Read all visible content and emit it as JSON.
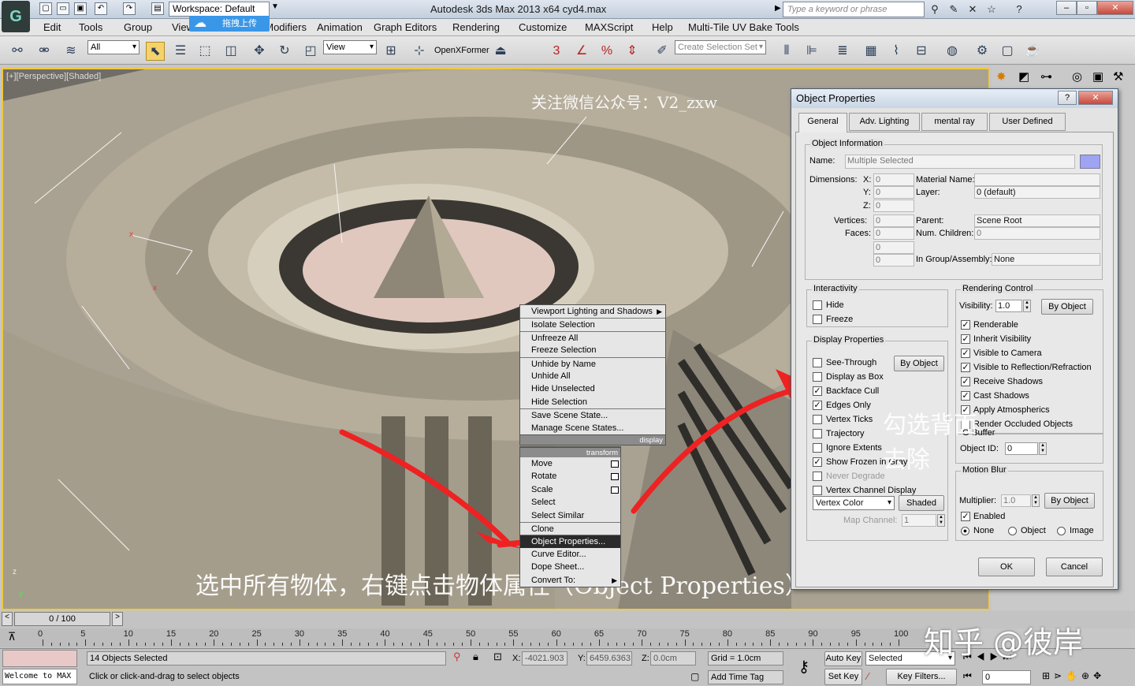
{
  "titlebar": {
    "workspace": "Workspace: Default",
    "upload": "拖拽上传",
    "app_title": "Autodesk 3ds Max  2013 x64      cyd4.max",
    "search_placeholder": "Type a keyword or phrase"
  },
  "menu": [
    "Edit",
    "Tools",
    "Group",
    "Views",
    "Create",
    "Modifiers",
    "Animation",
    "Graph Editors",
    "Rendering",
    "Customize",
    "MAXScript",
    "Help",
    "Multi-Tile UV Bake Tools"
  ],
  "toolbar": {
    "filter": "All",
    "refcoord": "View",
    "openxformer": "OpenXFormer",
    "selset_placeholder": "Create Selection Set"
  },
  "viewport": {
    "label": "[+][Perspective][Shaded]",
    "watermark_top": "关注微信公众号：V2_zxw",
    "watermark_bottom": "选中所有物体，右键点击物体属性（Object  Properties）",
    "annotation": "勾选背面去除",
    "zhihu": "知乎 @彼岸"
  },
  "context_menu": {
    "display_items": [
      "Viewport Lighting and Shadows",
      "Isolate Selection",
      "Unfreeze All",
      "Freeze Selection",
      "Unhide by Name",
      "Unhide All",
      "Hide Unselected",
      "Hide Selection",
      "Save Scene State...",
      "Manage Scene States..."
    ],
    "display_label": "display",
    "transform_label": "transform",
    "transform_items": [
      "Move",
      "Rotate",
      "Scale",
      "Select",
      "Select Similar",
      "Clone",
      "Object Properties...",
      "Curve Editor...",
      "Dope Sheet...",
      "Convert To:"
    ]
  },
  "dialog": {
    "title": "Object Properties",
    "tabs": [
      "General",
      "Adv. Lighting",
      "mental ray",
      "User Defined"
    ],
    "object_info": {
      "legend": "Object Information",
      "name_label": "Name:",
      "name_value": "Multiple Selected",
      "dimensions_label": "Dimensions:",
      "x": "X:",
      "y": "Y:",
      "z": "Z:",
      "zero": "0",
      "material_label": "Material Name:",
      "layer_label": "Layer:",
      "layer_value": "0 (default)",
      "vertices_label": "Vertices:",
      "faces_label": "Faces:",
      "parent_label": "Parent:",
      "parent_value": "Scene Root",
      "children_label": "Num. Children:",
      "group_label": "In Group/Assembly:",
      "group_value": "None"
    },
    "interactivity": {
      "legend": "Interactivity",
      "hide": "Hide",
      "freeze": "Freeze"
    },
    "display_props": {
      "legend": "Display Properties",
      "by_object": "By Object",
      "items": [
        {
          "label": "See-Through",
          "checked": false
        },
        {
          "label": "Display as Box",
          "checked": false
        },
        {
          "label": "Backface Cull",
          "checked": true
        },
        {
          "label": "Edges Only",
          "checked": true
        },
        {
          "label": "Vertex Ticks",
          "checked": false
        },
        {
          "label": "Trajectory",
          "checked": false
        },
        {
          "label": "Ignore Extents",
          "checked": false
        },
        {
          "label": "Show Frozen in Gray",
          "checked": true
        },
        {
          "label": "Never Degrade",
          "checked": false
        },
        {
          "label": "Vertex Channel Display",
          "checked": false
        }
      ],
      "vertex_color": "Vertex Color",
      "shaded": "Shaded",
      "map_channel_label": "Map Channel:",
      "map_channel": "1"
    },
    "rendering": {
      "legend": "Rendering Control",
      "visibility_label": "Visibility:",
      "visibility": "1.0",
      "by_object": "By Object",
      "items": [
        "Renderable",
        "Inherit Visibility",
        "Visible to Camera",
        "Visible to Reflection/Refraction",
        "Receive Shadows",
        "Cast Shadows",
        "Apply Atmospherics",
        "Render Occluded Objects"
      ]
    },
    "gbuffer": {
      "legend": "G-Buffer",
      "object_id_label": "Object ID:",
      "object_id": "0"
    },
    "motion_blur": {
      "legend": "Motion Blur",
      "multiplier_label": "Multiplier:",
      "multiplier": "1.0",
      "by_object": "By Object",
      "enabled": "Enabled",
      "none": "None",
      "object": "Object",
      "image": "Image"
    },
    "ok": "OK",
    "cancel": "Cancel"
  },
  "timeline": {
    "frame": "0 / 100",
    "ticks": [
      "0",
      "5",
      "10",
      "15",
      "20",
      "25",
      "30",
      "35",
      "40",
      "45",
      "50",
      "55",
      "60",
      "65",
      "70",
      "75",
      "80",
      "85",
      "90",
      "95",
      "100"
    ]
  },
  "status": {
    "maxscript": "Welcome to MAX",
    "selected": "14 Objects Selected",
    "prompt": "Click or click-and-drag to select objects",
    "x_label": "X:",
    "x": "-4021.903",
    "y_label": "Y:",
    "y": "6459.6363",
    "z_label": "Z:",
    "z": "0.0cm",
    "grid": "Grid = 1.0cm",
    "add_time_tag": "Add Time Tag",
    "auto_key": "Auto Key",
    "set_key": "Set Key",
    "selected_dd": "Selected",
    "key_filters": "Key Filters...",
    "frame_field": "0"
  }
}
